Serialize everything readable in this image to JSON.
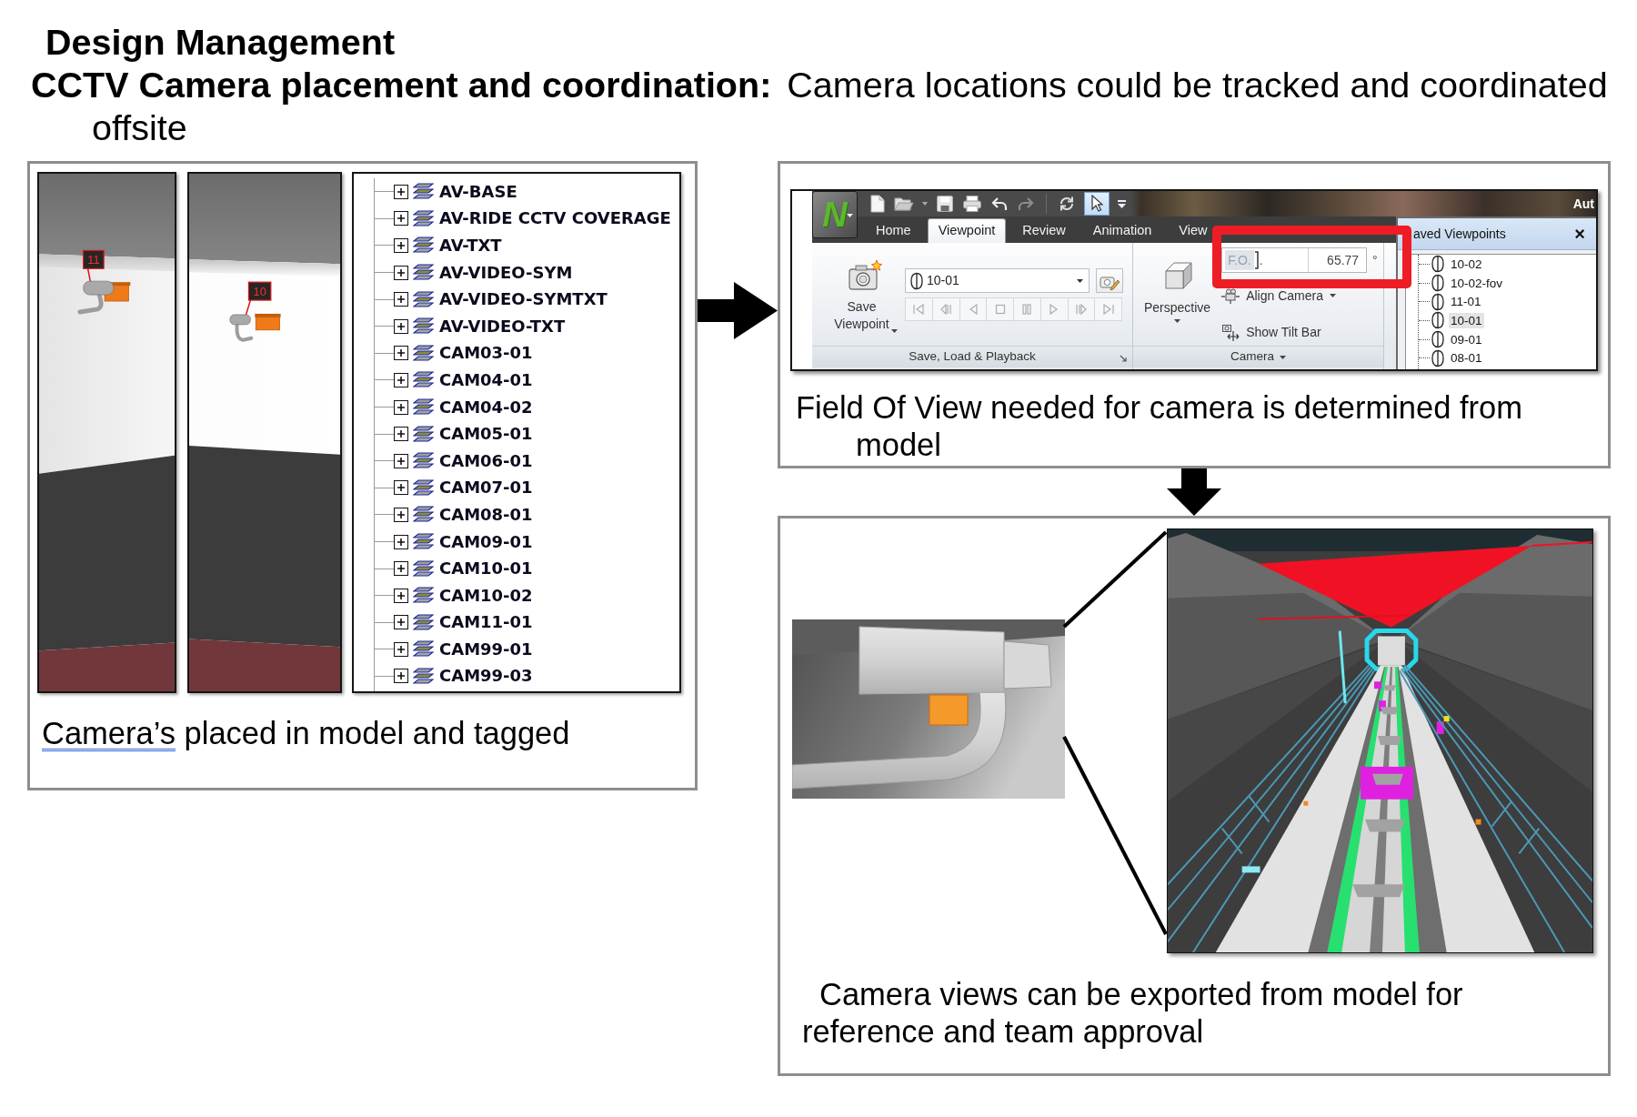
{
  "heading": {
    "title": "Design Management",
    "subtitle": "CCTV Camera placement and coordination:",
    "description": "Camera locations could be tracked and coordinated offsite"
  },
  "layer_panel": {
    "renders": [
      {
        "camera_tag": "11"
      },
      {
        "camera_tag": "10"
      }
    ],
    "layers": [
      {
        "label": "AV-BASE",
        "expanded": false
      },
      {
        "label": "AV-RIDE CCTV COVERAGE",
        "expanded": false
      },
      {
        "label": "AV-TXT",
        "expanded": false
      },
      {
        "label": "AV-VIDEO-SYM",
        "expanded": false
      },
      {
        "label": "AV-VIDEO-SYMTXT",
        "expanded": false
      },
      {
        "label": "AV-VIDEO-TXT",
        "expanded": false
      },
      {
        "label": "CAM03-01",
        "expanded": false
      },
      {
        "label": "CAM04-01",
        "expanded": false
      },
      {
        "label": "CAM04-02",
        "expanded": false
      },
      {
        "label": "CAM05-01",
        "expanded": false
      },
      {
        "label": "CAM06-01",
        "expanded": false
      },
      {
        "label": "CAM07-01",
        "expanded": false
      },
      {
        "label": "CAM08-01",
        "expanded": false
      },
      {
        "label": "CAM09-01",
        "expanded": false
      },
      {
        "label": "CAM10-01",
        "expanded": false
      },
      {
        "label": "CAM10-02",
        "expanded": false
      },
      {
        "label": "CAM11-01",
        "expanded": false
      },
      {
        "label": "CAM99-01",
        "expanded": false
      },
      {
        "label": "CAM99-03",
        "expanded": false
      }
    ],
    "caption": {
      "underlined_word": "Camera’s",
      "rest": "placed in model and tagged"
    }
  },
  "viewpoint_panel": {
    "ribbon": {
      "logo": "N",
      "title_fragment": "Aut",
      "tabs": [
        {
          "label": "Home",
          "selected": false
        },
        {
          "label": "Viewpoint",
          "selected": true
        },
        {
          "label": "Review",
          "selected": false
        },
        {
          "label": "Animation",
          "selected": false
        },
        {
          "label": "View",
          "selected": false
        }
      ],
      "save_button": "Save Viewpoint",
      "viewpoint_select": "10-01",
      "playback_buttons": [
        {
          "kind": "first",
          "disabled": true
        },
        {
          "kind": "step_back",
          "disabled": true
        },
        {
          "kind": "play_back",
          "disabled": true
        },
        {
          "kind": "stop",
          "disabled": true
        },
        {
          "kind": "pause",
          "disabled": true
        },
        {
          "kind": "play",
          "disabled": true
        },
        {
          "kind": "step_forward",
          "disabled": true
        },
        {
          "kind": "last",
          "disabled": true
        }
      ],
      "playback_group": "Save, Load & Playback",
      "perspective_button": "Perspective",
      "fov_field": {
        "label": "F.O.",
        "label_tail": ".",
        "value": "65.77",
        "unit": "°"
      },
      "align_camera": "Align Camera",
      "show_tilt_bar": "Show Tilt Bar",
      "camera_group": "Camera"
    },
    "saved_viewpoints": {
      "title": "aved Viewpoints",
      "close": "×",
      "items": [
        {
          "label": "10-02",
          "selected": false
        },
        {
          "label": "10-02-fov",
          "selected": false
        },
        {
          "label": "11-01",
          "selected": false
        },
        {
          "label": "10-01",
          "selected": true
        },
        {
          "label": "09-01",
          "selected": false
        },
        {
          "label": "08-01",
          "selected": false
        }
      ]
    },
    "caption": "Field Of View needed for camera is determined from model"
  },
  "export_panel": {
    "caption": "Camera views can be exported from model for reference and team approval"
  }
}
